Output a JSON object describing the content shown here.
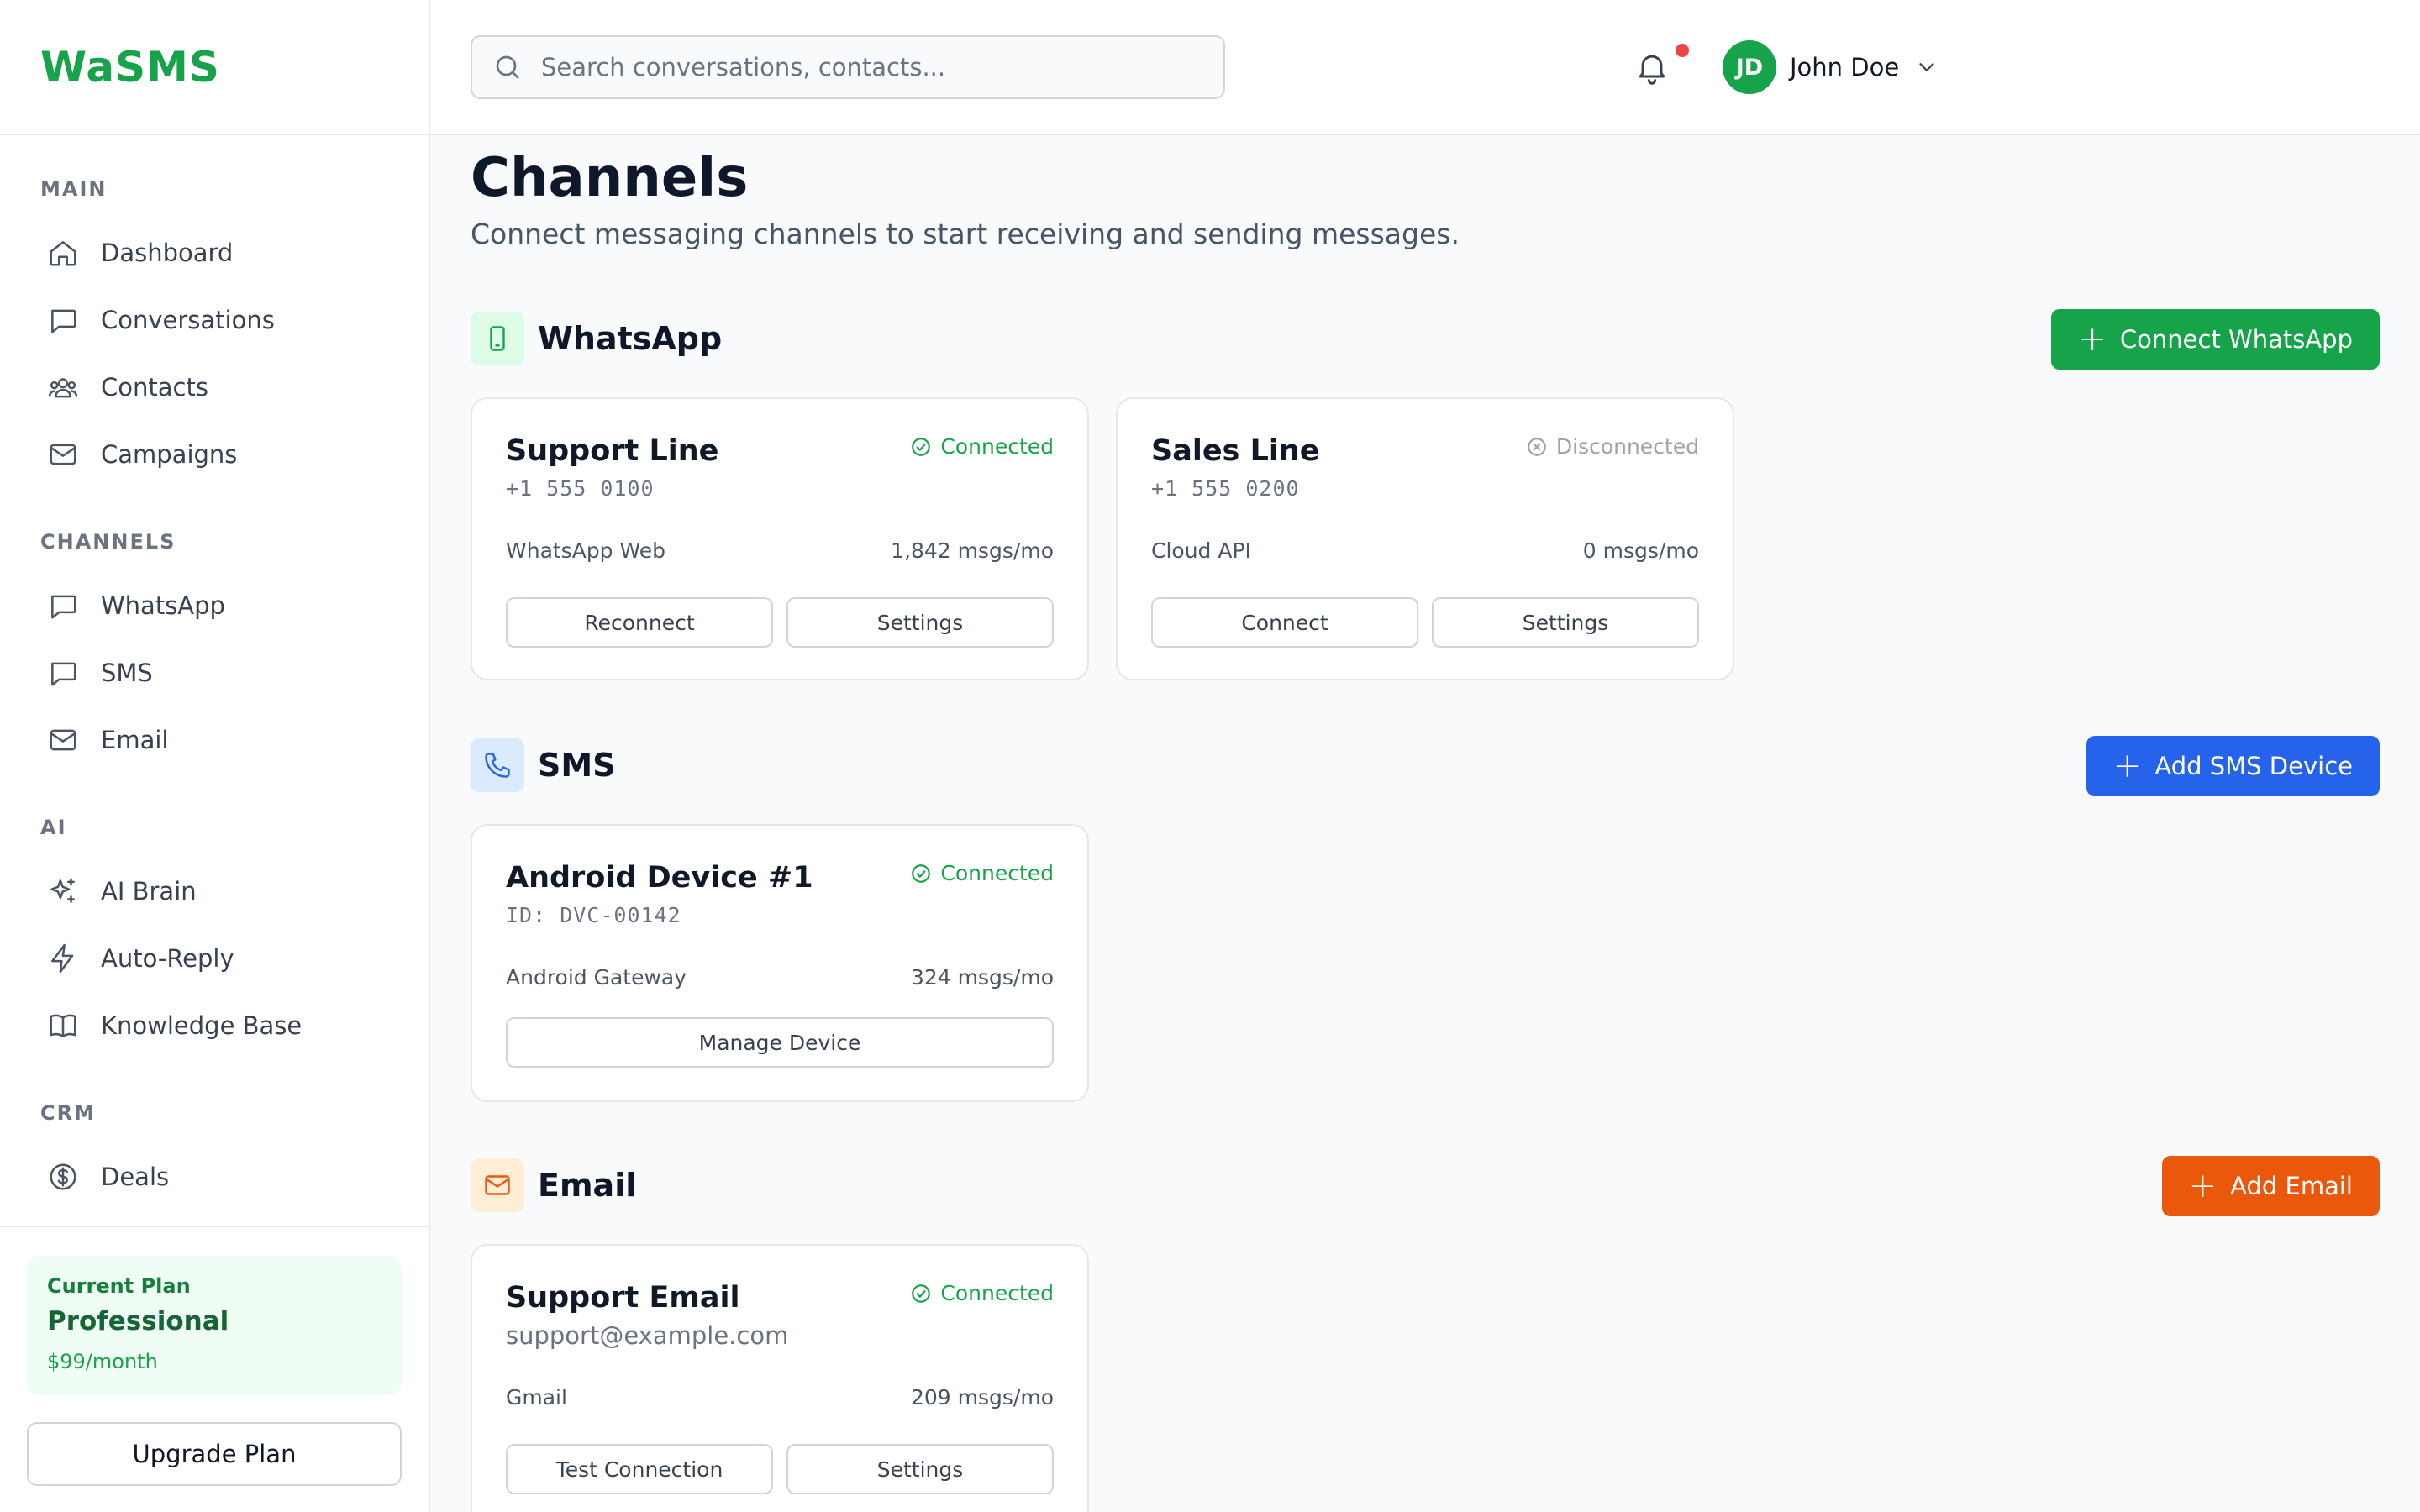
{
  "app": {
    "logo": "WaSMS"
  },
  "search": {
    "placeholder": "Search conversations, contacts..."
  },
  "user": {
    "initials": "JD",
    "name": "John Doe"
  },
  "sidebar": {
    "sections": [
      {
        "title": "MAIN",
        "items": [
          "Dashboard",
          "Conversations",
          "Contacts",
          "Campaigns"
        ]
      },
      {
        "title": "CHANNELS",
        "items": [
          "WhatsApp",
          "SMS",
          "Email"
        ]
      },
      {
        "title": "AI",
        "items": [
          "AI Brain",
          "Auto-Reply",
          "Knowledge Base"
        ]
      },
      {
        "title": "CRM",
        "items": [
          "Deals"
        ]
      }
    ],
    "plan": {
      "label": "Current Plan",
      "name": "Professional",
      "price": "$99/month"
    },
    "upgrade_label": "Upgrade Plan"
  },
  "page": {
    "title": "Channels",
    "subtitle": "Connect messaging channels to start receiving and sending messages."
  },
  "channels": {
    "whatsapp": {
      "title": "WhatsApp",
      "action": "Connect WhatsApp",
      "cards": [
        {
          "name": "Support Line",
          "sub": "+1 555 0100",
          "status": "Connected",
          "type": "WhatsApp Web",
          "volume": "1,842 msgs/mo",
          "buttons": [
            "Reconnect",
            "Settings"
          ]
        },
        {
          "name": "Sales Line",
          "sub": "+1 555 0200",
          "status": "Disconnected",
          "type": "Cloud API",
          "volume": "0 msgs/mo",
          "buttons": [
            "Connect",
            "Settings"
          ]
        }
      ]
    },
    "sms": {
      "title": "SMS",
      "action": "Add SMS Device",
      "cards": [
        {
          "name": "Android Device #1",
          "sub": "ID: DVC-00142",
          "status": "Connected",
          "type": "Android Gateway",
          "volume": "324 msgs/mo",
          "buttons": [
            "Manage Device"
          ]
        }
      ]
    },
    "email": {
      "title": "Email",
      "action": "Add Email",
      "cards": [
        {
          "name": "Support Email",
          "sub": "support@example.com",
          "status": "Connected",
          "type": "Gmail",
          "volume": "209 msgs/mo",
          "buttons": [
            "Test Connection",
            "Settings"
          ]
        }
      ]
    }
  },
  "colors": {
    "brand": "#16a34a",
    "whatsapp_button": "#16a34a",
    "sms_button": "#2563eb",
    "email_button": "#ea580c",
    "connected": "#16a34a",
    "disconnected": "#9ca3af",
    "notification_dot": "#ef4444"
  },
  "icons": {
    "nav": [
      "home-icon",
      "chat-icon",
      "users-icon",
      "mail-icon",
      "chat-icon",
      "chat-icon",
      "mail-icon",
      "sparkles-icon",
      "bolt-icon",
      "book-icon",
      "dollar-icon"
    ],
    "channels": [
      "phone-device-icon",
      "phone-icon",
      "mail-icon"
    ]
  }
}
